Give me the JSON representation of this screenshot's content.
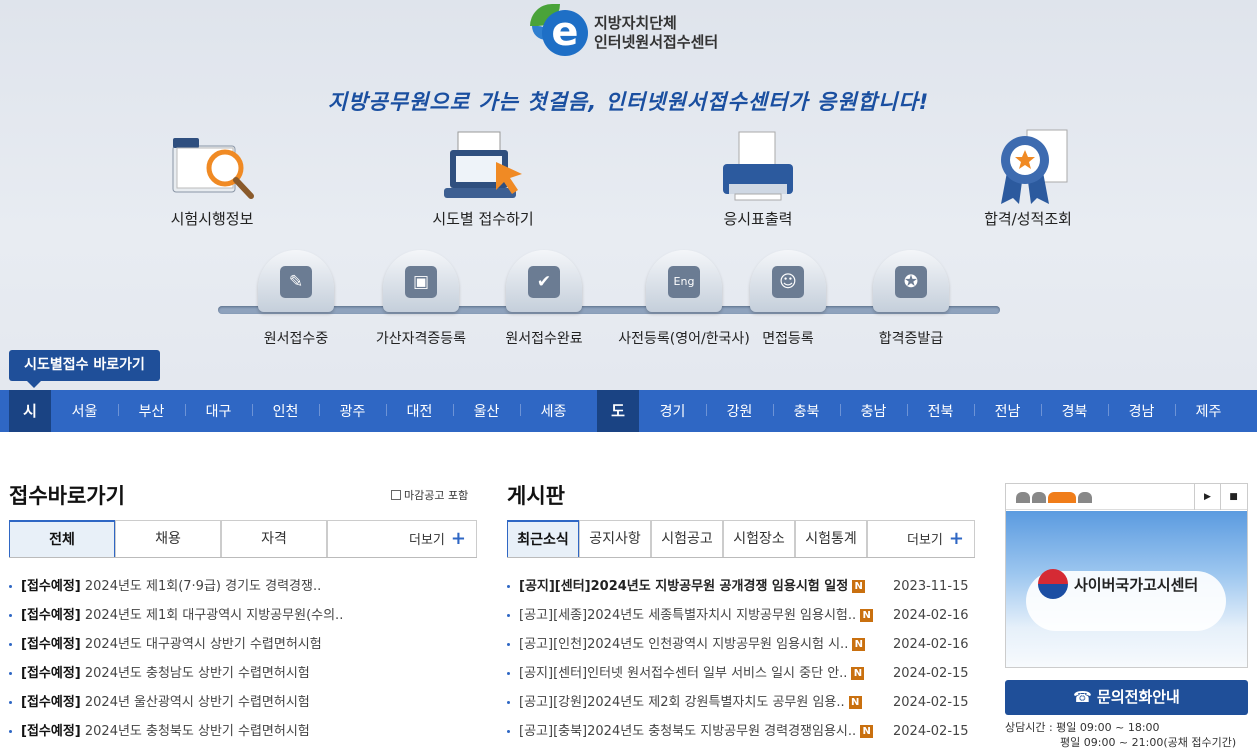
{
  "header": {
    "logo_line1": "지방자치단체",
    "logo_line2": "인터넷원서접수센터",
    "slogan": "지방공무원으로 가는 첫걸음, 인터넷원서접수센터가 응원합니다!"
  },
  "main_menu": [
    {
      "label": "시험시행정보",
      "icon": "folder-search-icon"
    },
    {
      "label": "시도별 접수하기",
      "icon": "laptop-click-icon"
    },
    {
      "label": "응시표출력",
      "icon": "printer-icon"
    },
    {
      "label": "합격/성적조회",
      "icon": "award-ribbon-icon"
    }
  ],
  "steps": [
    {
      "label": "원서접수중",
      "icon": "pencil-icon"
    },
    {
      "label": "가산자격증등록",
      "icon": "id-card-icon"
    },
    {
      "label": "원서접수완료",
      "icon": "check-icon"
    },
    {
      "label": "사전등록(영어/한국사)",
      "icon": "eng-document-icon"
    },
    {
      "label": "면접등록",
      "icon": "interview-icon"
    },
    {
      "label": "합격증발급",
      "icon": "medal-icon"
    }
  ],
  "jump_label": "시도별접수 바로가기",
  "region_nav": {
    "si_label": "시",
    "si": [
      "서울",
      "부산",
      "대구",
      "인천",
      "광주",
      "대전",
      "울산",
      "세종"
    ],
    "do_label": "도",
    "do": [
      "경기",
      "강원",
      "충북",
      "충남",
      "전북",
      "전남",
      "경북",
      "경남",
      "제주"
    ]
  },
  "quick": {
    "title": "접수바로가기",
    "closed_checkbox": "마감공고 포함",
    "tabs": [
      "전체",
      "채용",
      "자격"
    ],
    "more": "더보기",
    "items": [
      {
        "tag": "[접수예정]",
        "text": "2024년도 제1회(7·9급) 경기도 경력경쟁.."
      },
      {
        "tag": "[접수예정]",
        "text": "2024년도 제1회 대구광역시 지방공무원(수의.."
      },
      {
        "tag": "[접수예정]",
        "text": "2024년도 대구광역시 상반기 수렵면허시험"
      },
      {
        "tag": "[접수예정]",
        "text": "2024년도 충청남도 상반기 수렵면허시험"
      },
      {
        "tag": "[접수예정]",
        "text": "2024년 울산광역시 상반기 수렵면허시험"
      },
      {
        "tag": "[접수예정]",
        "text": "2024년도 충청북도 상반기 수렵면허시험"
      }
    ]
  },
  "board": {
    "title": "게시판",
    "tabs": [
      "최근소식",
      "공지사항",
      "시험공고",
      "시험장소",
      "시험통계"
    ],
    "more": "더보기",
    "new_badge": "N",
    "items": [
      {
        "text": "[공지][센터]2024년도 지방공무원 공개경쟁 임용시험 일정",
        "date": "2023-11-15",
        "bold": true
      },
      {
        "text": "[공고][세종]2024년도 세종특별자치시 지방공무원 임용시험..",
        "date": "2024-02-16",
        "bold": false
      },
      {
        "text": "[공고][인천]2024년도 인천광역시 지방공무원 임용시험 시..",
        "date": "2024-02-16",
        "bold": false
      },
      {
        "text": "[공지][센터]인터넷 원서접수센터 일부 서비스 일시 중단 안..",
        "date": "2024-02-15",
        "bold": false
      },
      {
        "text": "[공고][강원]2024년도 제2회 강원특별자치도 공무원 임용..",
        "date": "2024-02-15",
        "bold": false
      },
      {
        "text": "[공고][충북]2024년도 충청북도 지방공무원 경력경쟁임용시..",
        "date": "2024-02-15",
        "bold": false
      }
    ]
  },
  "banner": {
    "name": "사이버국가고시센터",
    "play": "▶",
    "stop": "■"
  },
  "contact": {
    "button": "☎ 문의전화안내",
    "hours_line1": "상담시간 : 평일 09:00 ~ 18:00",
    "hours_line2": "평일 09:00 ~ 21:00(공채 접수기간)"
  }
}
